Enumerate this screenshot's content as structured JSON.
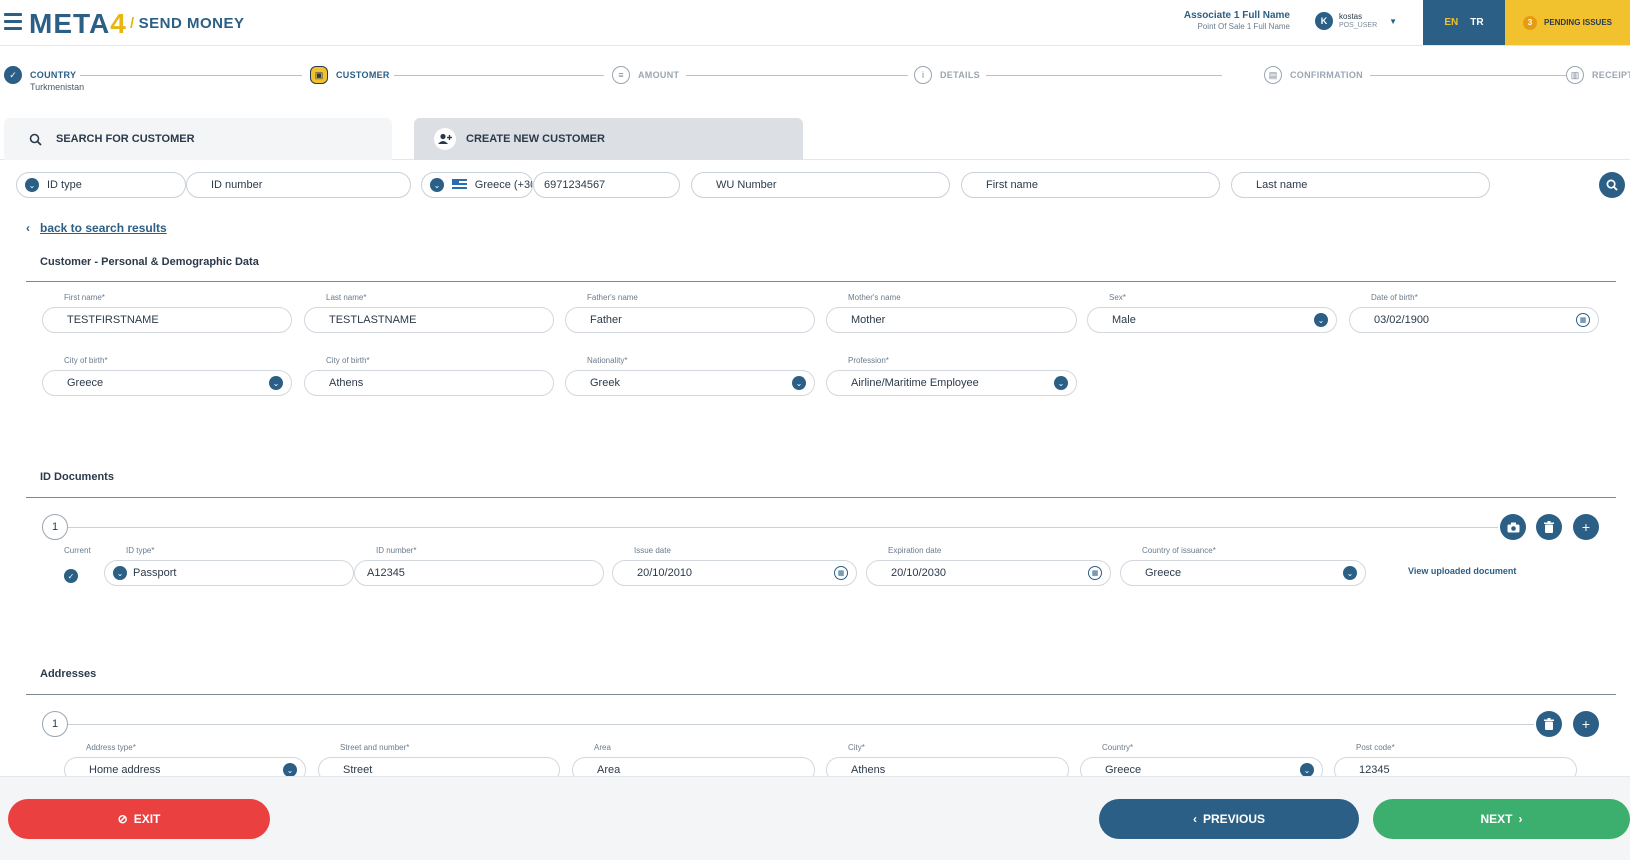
{
  "header": {
    "logo_main": "META",
    "logo_four": "4",
    "title": "SEND MONEY",
    "associate_name": "Associate 1 Full Name",
    "associate_sub": "Point Of Sale 1 Full Name",
    "user_initial": "K",
    "user_name": "kostas",
    "user_role": "POS_USER",
    "lang_en": "EN",
    "lang_tr": "TR",
    "pending_count": "3",
    "pending_label": "PENDING ISSUES"
  },
  "stepper": {
    "steps": [
      {
        "label": "COUNTRY",
        "sub": "Turkmenistan",
        "state": "done"
      },
      {
        "label": "CUSTOMER",
        "sub": "",
        "state": "active"
      },
      {
        "label": "AMOUNT",
        "sub": "",
        "state": "pending"
      },
      {
        "label": "DETAILS",
        "sub": "",
        "state": "pending"
      },
      {
        "label": "CONFIRMATION",
        "sub": "",
        "state": "pending"
      },
      {
        "label": "RECEIPT",
        "sub": "",
        "state": "pending"
      }
    ]
  },
  "tabs": {
    "search_label": "SEARCH FOR CUSTOMER",
    "create_label": "CREATE NEW CUSTOMER"
  },
  "search": {
    "id_type_value": "ID type",
    "id_number_placeholder": "ID number",
    "phone_country": "Greece (+30",
    "phone_value": "6971234567",
    "wu_number_placeholder": "WU Number",
    "first_name_placeholder": "First name",
    "last_name_placeholder": "Last name"
  },
  "back_link": "back to search results",
  "personal": {
    "section_title": "Customer - Personal & Demographic Data",
    "first_name_label": "First name*",
    "first_name": "TESTFIRSTNAME",
    "last_name_label": "Last name*",
    "last_name": "TESTLASTNAME",
    "father_label": "Father's name",
    "father": "Father",
    "mother_label": "Mother's name",
    "mother": "Mother",
    "sex_label": "Sex*",
    "sex": "Male",
    "dob_label": "Date of birth*",
    "dob": "03/02/1900",
    "country_birth_label": "City of birth*",
    "country_birth": "Greece",
    "city_birth_label": "City of birth*",
    "city_birth": "Athens",
    "nationality_label": "Nationality*",
    "nationality": "Greek",
    "profession_label": "Profession*",
    "profession": "Airline/Maritime Employee"
  },
  "id_documents": {
    "section_title": "ID Documents",
    "index": "1",
    "current_label": "Current",
    "id_type_label": "ID type*",
    "id_type": "Passport",
    "id_number_label": "ID number*",
    "id_number": "A12345",
    "issue_label": "Issue date",
    "issue_date": "20/10/2010",
    "expiry_label": "Expiration date",
    "expiry_date": "20/10/2030",
    "country_label": "Country of issuance*",
    "country": "Greece",
    "view_doc": "View uploaded document"
  },
  "addresses": {
    "section_title": "Addresses",
    "index": "1",
    "type_label": "Address type*",
    "type": "Home address",
    "street_label": "Street and number*",
    "street": "Street",
    "area_label": "Area",
    "area": "Area",
    "city_label": "City*",
    "city": "Athens",
    "country_label": "Country*",
    "country": "Greece",
    "postcode_label": "Post code*",
    "postcode": "12345"
  },
  "footer": {
    "exit_label": "EXIT",
    "previous_label": "PREVIOUS",
    "next_label": "NEXT"
  },
  "colors": {
    "primary": "#2b5f85",
    "accent": "#f2c12e",
    "exit": "#ea4040",
    "next": "#3cae6e"
  }
}
